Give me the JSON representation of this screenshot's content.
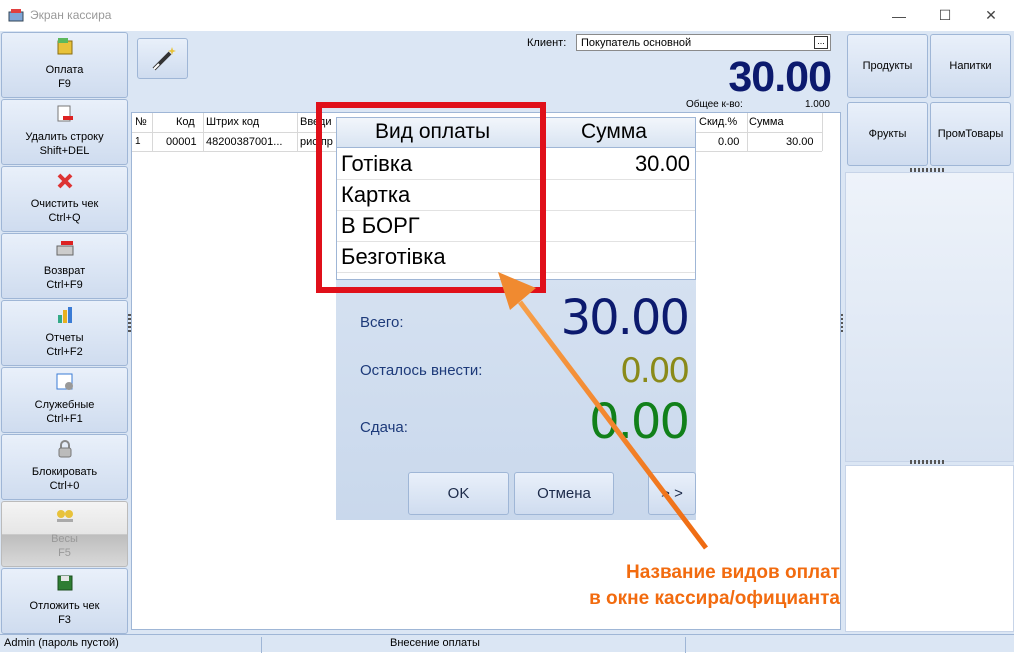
{
  "window": {
    "title": "Экран кассира",
    "minimize": "—",
    "maximize": "☐",
    "close": "✕"
  },
  "left_toolbar": [
    {
      "label": "Оплата",
      "key": "F9",
      "icon": "coins-icon"
    },
    {
      "label": "Удалить строку",
      "key": "Shift+DEL",
      "icon": "delete-line-icon"
    },
    {
      "label": "Очистить чек",
      "key": "Ctrl+Q",
      "icon": "clear-x-icon"
    },
    {
      "label": "Возврат",
      "key": "Ctrl+F9",
      "icon": "return-icon"
    },
    {
      "label": "Отчеты",
      "key": "Ctrl+F2",
      "icon": "chart-icon"
    },
    {
      "label": "Служебные",
      "key": "Ctrl+F1",
      "icon": "service-icon"
    },
    {
      "label": "Блокировать",
      "key": "Ctrl+0",
      "icon": "lock-icon"
    },
    {
      "label": "Весы",
      "key": "F5",
      "icon": "scales-icon"
    },
    {
      "label": "Отложить чек",
      "key": "F3",
      "icon": "floppy-icon"
    }
  ],
  "client": {
    "label": "Клиент:",
    "value": "Покупатель основной",
    "browse": "..."
  },
  "totals": {
    "sum": "30.00",
    "qty_label": "Общее к-во:",
    "qty": "1.000"
  },
  "receipt_table": {
    "headers": {
      "num": "№",
      "code": "Код",
      "barcode": "Штрих код",
      "name": "Введи",
      "discount": "Скид.%",
      "sum": "Сумма"
    },
    "row": {
      "num": "1",
      "code": "00001",
      "barcode": "48200387001...",
      "name": "рис пр",
      "discount": "0.00",
      "sum": "30.00"
    }
  },
  "categories": [
    "Продукты",
    "Напитки",
    "Фрукты",
    "ПромТовары"
  ],
  "payment": {
    "header_type": "Вид оплаты",
    "header_sum": "Сумма",
    "rows": [
      {
        "name": "Готівка",
        "sum": "30.00"
      },
      {
        "name": "Картка",
        "sum": ""
      },
      {
        "name": "В БОРГ",
        "sum": ""
      },
      {
        "name": "Безготівка",
        "sum": ""
      }
    ],
    "total_label": "Всего:",
    "total": "30.00",
    "remaining_label": "Осталось внести:",
    "remaining": "0.00",
    "change_label": "Сдача:",
    "change": "0.00",
    "ok": "OK",
    "cancel": "Отмена",
    "next": "> >"
  },
  "annotation": {
    "line1": "Название видов оплат",
    "line2": "в окне кассира/официанта",
    "color": "#f26b0f"
  },
  "status": {
    "user": "Admin (пароль пустой)",
    "mode": "Внесение оплаты"
  },
  "colors": {
    "total_blue": "#0c1a6e",
    "remaining_olive": "#8a8a1a",
    "change_green": "#11801a",
    "highlight_red": "#e0101a"
  }
}
